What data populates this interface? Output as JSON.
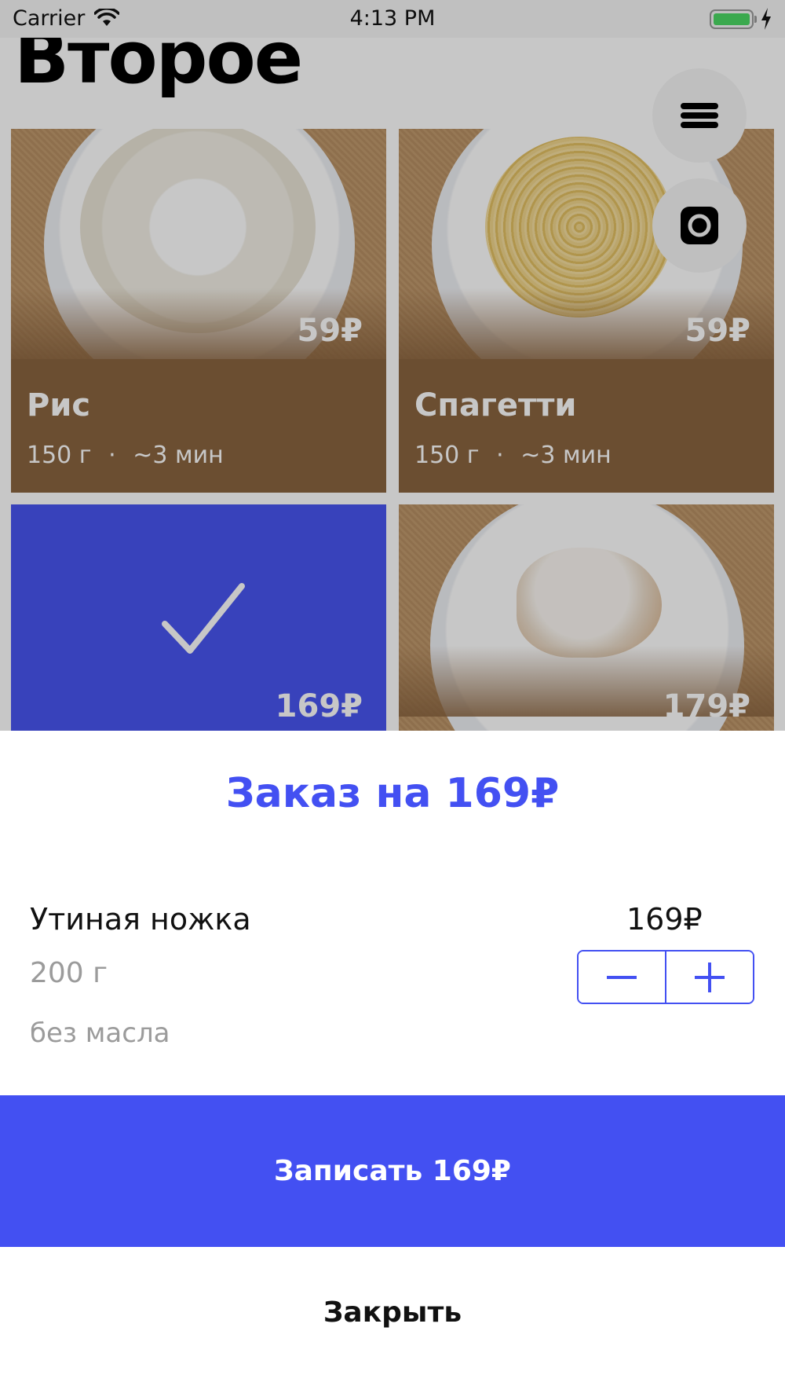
{
  "status_bar": {
    "carrier": "Carrier",
    "time": "4:13 PM"
  },
  "page": {
    "title": "Второе"
  },
  "dishes": [
    {
      "name": "Рис",
      "weight": "150 г",
      "separator": "·",
      "time": "~3 мин",
      "price": "59₽",
      "image": "rice-plate"
    },
    {
      "name": "Спагетти",
      "weight": "150 г",
      "separator": "·",
      "time": "~3 мин",
      "price": "59₽",
      "image": "spaghetti-plate"
    },
    {
      "price": "169₽",
      "selected": true,
      "image": "checkmark-icon"
    },
    {
      "price": "179₽",
      "image": "fish-plate"
    }
  ],
  "fabs": [
    {
      "icon": "menu-icon"
    },
    {
      "icon": "camera-icon"
    }
  ],
  "order": {
    "title": "Заказ на 169₽",
    "item": {
      "name": "Утиная ножка",
      "weight": "200 г",
      "note": "без масла",
      "price": "169₽"
    },
    "stepper": {
      "decrement_icon": "minus-icon",
      "increment_icon": "plus-icon"
    },
    "submit_label": "Записать 169₽",
    "close_label": "Закрыть"
  },
  "colors": {
    "accent": "#4350f2",
    "card_info": "#8a643f",
    "selected_card": "#4855f0",
    "battery": "#4cd964"
  }
}
